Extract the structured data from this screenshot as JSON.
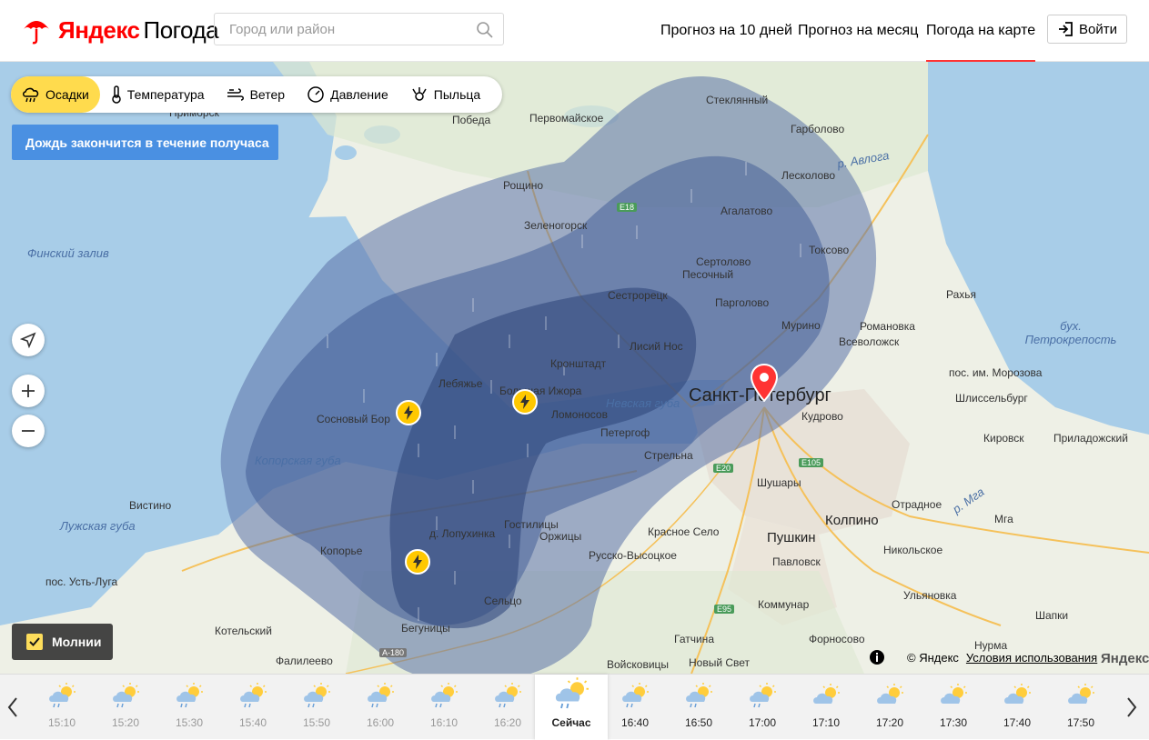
{
  "header": {
    "brand_ya": "Яндекс",
    "brand_pg": "Погода",
    "search_placeholder": "Город или район",
    "nav": [
      "Прогноз на 10 дней",
      "Прогноз на месяц",
      "Погода на карте"
    ],
    "active_nav": "Погода на карте",
    "login": "Войти"
  },
  "layers": [
    "Осадки",
    "Температура",
    "Ветер",
    "Давление",
    "Пыльца"
  ],
  "active_layer": "Осадки",
  "banner": "Дождь закончится в течение получаса",
  "lightning_toggle": "Молнии",
  "copyright": "© Яндекс",
  "terms": "Условия использования",
  "watermark": "Яндекс",
  "map_labels": {
    "places": [
      "Приморск",
      "Победа",
      "Первомайское",
      "Стеклянный",
      "Гарболово",
      "Рощино",
      "Лесколово",
      "Агалатово",
      "Зеленогорск",
      "Токсово",
      "Сертолово",
      "Песочный",
      "Рахья",
      "Парголово",
      "Сестрорецк",
      "Мурино",
      "Романовка",
      "Всеволожск",
      "Лисий Нос",
      "Кронштадт",
      "пос. им. Морозова",
      "Лебяжье",
      "Большая Ижора",
      "Шлиссельбург",
      "Сосновый Бор",
      "Ломоносов",
      "Кудрово",
      "Петергоф",
      "Кировск",
      "Приладожский",
      "Стрельна",
      "Шушары",
      "Вистино",
      "Отрадное",
      "Мга",
      "Гостилицы",
      "Красное Село",
      "д. Лопухинка",
      "Оржицы",
      "Пушкин",
      "Колпино",
      "Никольское",
      "Копорье",
      "Русско-Высоцкое",
      "Павловск",
      "пос. Усть-Луга",
      "Сельцо",
      "Ульяновка",
      "Коммунар",
      "Шапки",
      "Котельский",
      "Бегуницы",
      "Гатчина",
      "Форносово",
      "Нурма",
      "Фалилеево",
      "Войсковицы",
      "Новый Свет"
    ],
    "city": "Санкт-Петербург",
    "waters": [
      "Финский залив",
      "Копорская губа",
      "Лужская губа",
      "Невская губа",
      "бух. Петрокрепость",
      "р. Авлога",
      "р. Мга"
    ],
    "roads": [
      "E18",
      "E20",
      "E105",
      "E95",
      "A-180"
    ]
  },
  "timeline": {
    "past": [
      "15:10",
      "15:20",
      "15:30",
      "15:40",
      "15:50",
      "16:00",
      "16:10",
      "16:20"
    ],
    "now": "Сейчас",
    "future": [
      "16:40",
      "16:50",
      "17:00",
      "17:10",
      "17:20",
      "17:30",
      "17:40",
      "17:50"
    ]
  },
  "colors": {
    "accent": "#ffdb4d",
    "banner": "#4a90e2",
    "precip_light": "#7a8fbf",
    "precip_mid": "#5a6fa0",
    "precip_heavy": "#3d5080",
    "pin": "#f33"
  }
}
